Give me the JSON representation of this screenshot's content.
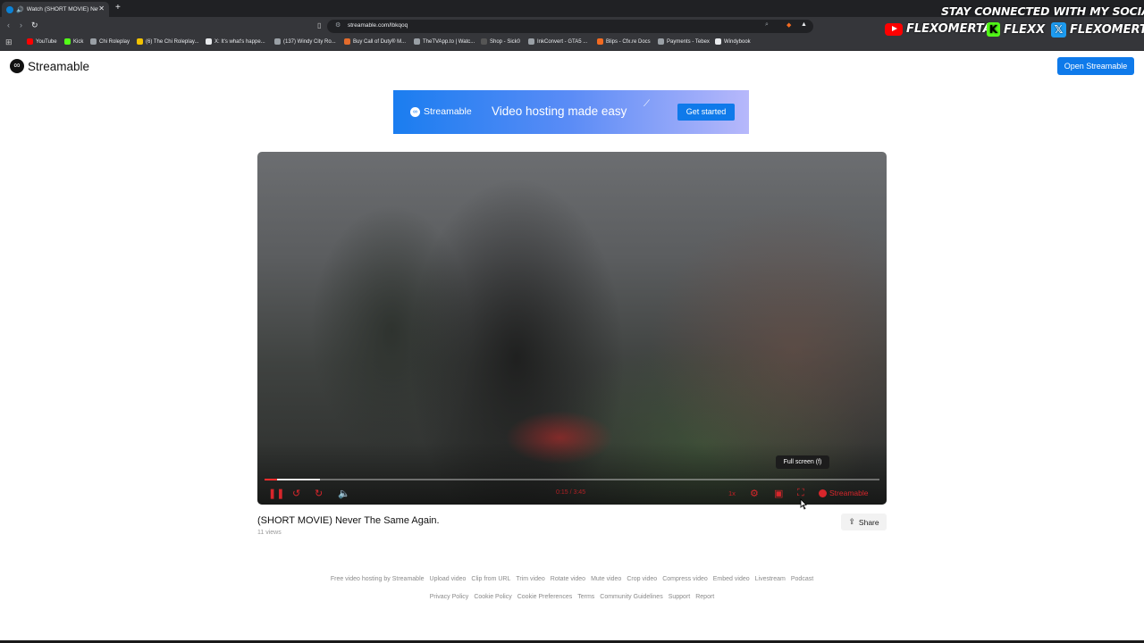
{
  "browser": {
    "tab_title": "Watch (SHORT MOVIE) Never",
    "new_tab_symbol": "+",
    "url": "streamable.com/lbkqoq",
    "bookmarks": [
      {
        "label": "YouTube",
        "color": "#ff0000"
      },
      {
        "label": "Kick",
        "color": "#53fc18"
      },
      {
        "label": "Chi Roleplay",
        "color": "#9aa0a6"
      },
      {
        "label": "(6) The Chi Roleplay...",
        "color": "#f2c200"
      },
      {
        "label": "X: It's what's happe...",
        "color": "#e8eaed"
      },
      {
        "label": "(137) Windy City Ro...",
        "color": "#9aa0a6"
      },
      {
        "label": "Buy Call of Duty® M...",
        "color": "#e36b2c"
      },
      {
        "label": "TheTVApp.to | Watc...",
        "color": "#9aa0a6"
      },
      {
        "label": "Shop - Sick0",
        "color": "#555"
      },
      {
        "label": "InkConvert - GTA5 ...",
        "color": "#9aa0a6"
      },
      {
        "label": "Blips - Cfx.re Docs",
        "color": "#f36b21"
      },
      {
        "label": "Payments - Tebex",
        "color": "#9aa0a6"
      },
      {
        "label": "Windybook",
        "color": "#e8eaed"
      }
    ]
  },
  "overlay": {
    "heading": "STAY CONNECTED WITH MY SOCIALS",
    "youtube": "FLEXOMERTA",
    "kick": "FLEXX",
    "x": "FLEXOMERTA"
  },
  "site": {
    "logo_text": "Streamable",
    "open_button": "Open Streamable"
  },
  "banner": {
    "brand": "Streamable",
    "tagline": "Video hosting made easy",
    "cta": "Get started"
  },
  "player": {
    "played_fraction": 0.02,
    "buffered_fraction": 0.09,
    "time": "0:15 / 3:45",
    "speed": "1x",
    "brand": "Streamable",
    "tooltip": "Full screen (f)",
    "accent": "#d7262b"
  },
  "video": {
    "title": "(SHORT MOVIE) Never The Same Again.",
    "views": "11 views",
    "share_label": "Share"
  },
  "footer": {
    "row1": [
      "Free video hosting by Streamable",
      "Upload video",
      "Clip from URL",
      "Trim video",
      "Rotate video",
      "Mute video",
      "Crop video",
      "Compress video",
      "Embed video",
      "Livestream",
      "Podcast"
    ],
    "row2": [
      "Privacy Policy",
      "Cookie Policy",
      "Cookie Preferences",
      "Terms",
      "Community Guidelines",
      "Support",
      "Report"
    ]
  }
}
